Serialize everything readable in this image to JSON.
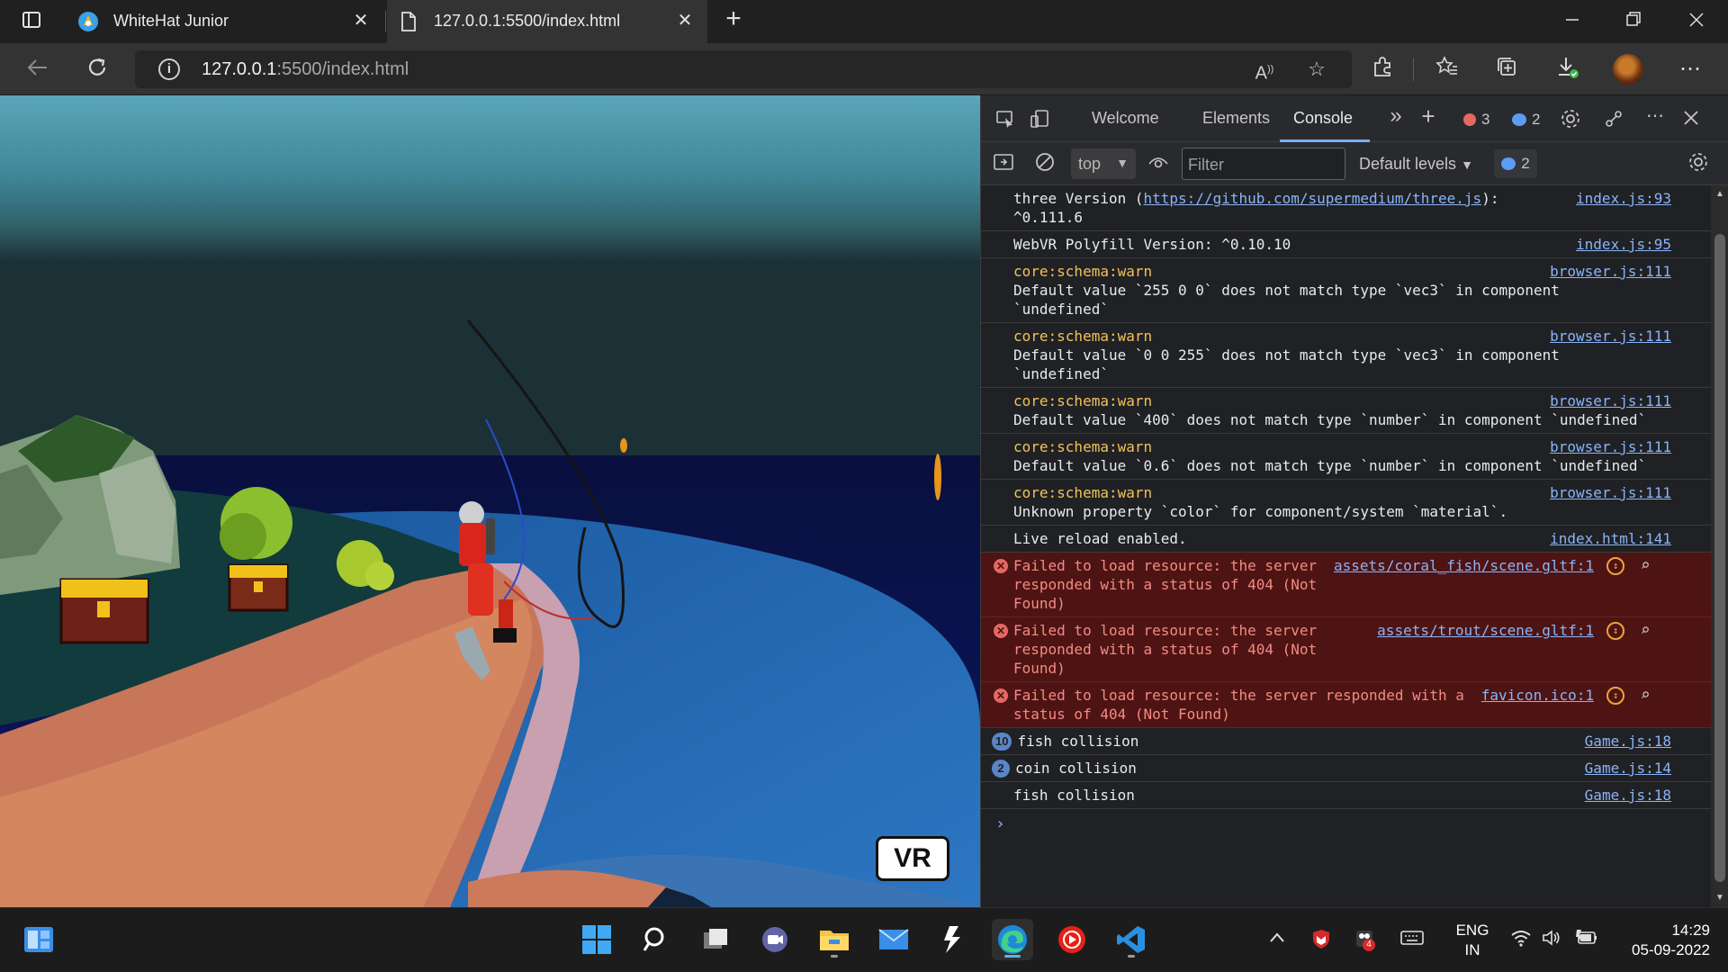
{
  "browser": {
    "tabs": [
      {
        "title": "WhiteHat Junior",
        "active": false
      },
      {
        "title": "127.0.0.1:5500/index.html",
        "active": true
      }
    ],
    "new_tab": "+",
    "address": {
      "host": "127.0.0.1",
      "rest": ":5500/index.html"
    }
  },
  "game": {
    "vr_button": "VR"
  },
  "devtools": {
    "tabs": [
      "Welcome",
      "Elements",
      "Console"
    ],
    "more_tabs": "»",
    "add_tab": "+",
    "error_count": "3",
    "message_count": "2",
    "context": "top",
    "filter_placeholder": "Filter",
    "levels": "Default levels",
    "issues_count": "2",
    "console": [
      {
        "type": "info",
        "text": "three Version (",
        "link": "https://github.com/supermedium/three.js",
        "text2": "):\n^0.111.6",
        "source": "index.js:93"
      },
      {
        "type": "info",
        "text": "WebVR Polyfill Version: ^0.10.10",
        "source": "index.js:95"
      },
      {
        "type": "warn",
        "tag": "core:schema:warn",
        "text": "Default value `255 0 0` does not match type `vec3` in component\n`undefined`\n",
        "source": "browser.js:111"
      },
      {
        "type": "warn",
        "tag": "core:schema:warn",
        "text": "Default value `0 0 255` does not match type `vec3` in component\n`undefined`\n",
        "source": "browser.js:111"
      },
      {
        "type": "warn",
        "tag": "core:schema:warn",
        "text": "Default value `400` does not match type `number` in component `undefined`",
        "source": "browser.js:111"
      },
      {
        "type": "warn",
        "tag": "core:schema:warn",
        "text": "Default value `0.6` does not match type `number` in component `undefined`",
        "source": "browser.js:111"
      },
      {
        "type": "warn",
        "tag": "core:schema:warn",
        "text": "Unknown property `color` for component/system `material`.",
        "source": "browser.js:111"
      },
      {
        "type": "info",
        "text": "Live reload enabled.",
        "source": "index.html:141"
      },
      {
        "type": "error",
        "text": "Failed to load resource: the server\nresponded with a status of 404 (Not\nFound)",
        "source": "assets/coral_fish/scene.gltf:1"
      },
      {
        "type": "error",
        "text": "Failed to load resource: the server\nresponded with a status of 404 (Not\nFound)",
        "source": "assets/trout/scene.gltf:1"
      },
      {
        "type": "error",
        "text": "Failed to load resource: the server responded with a\nstatus of 404 (Not Found)",
        "source": "favicon.ico:1"
      },
      {
        "type": "group",
        "count": "10",
        "text": "fish collision",
        "source": "Game.js:18"
      },
      {
        "type": "group",
        "count": "2",
        "text": "coin collision",
        "source": "Game.js:14"
      },
      {
        "type": "info",
        "text": "fish collision",
        "source": "Game.js:18"
      }
    ],
    "prompt": "›"
  },
  "taskbar": {
    "lang_top": "ENG",
    "lang_bottom": "IN",
    "time": "14:29",
    "date": "05-09-2022",
    "notification_badge": "4"
  },
  "colors": {
    "warn": "#f2c15b",
    "error_bg": "#4e1414",
    "error_text": "#f28b82",
    "link": "#8ab4f8"
  }
}
